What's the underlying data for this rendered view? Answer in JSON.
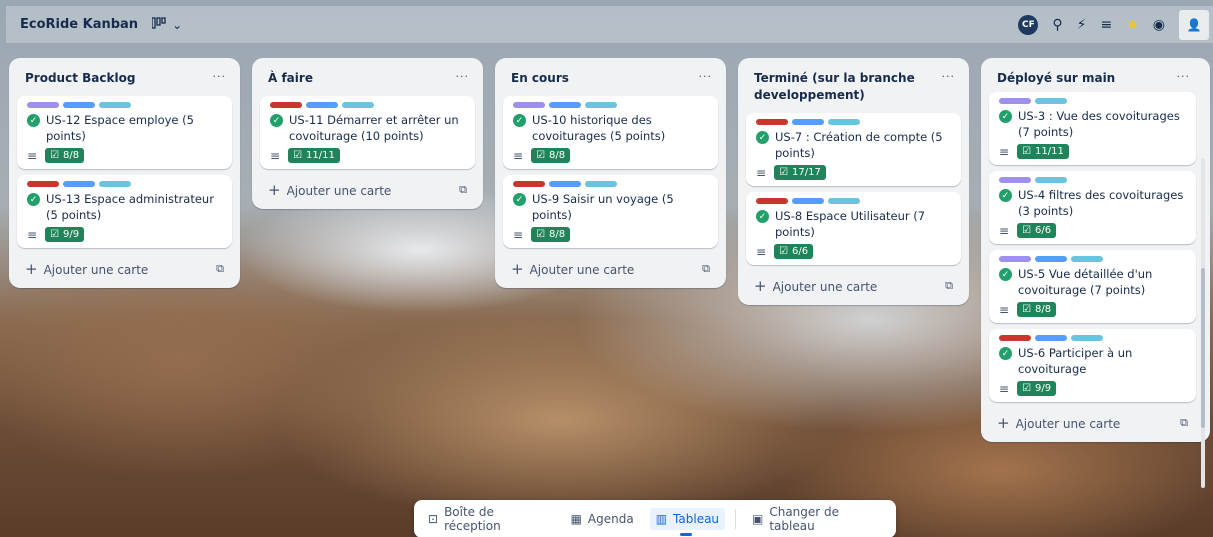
{
  "header": {
    "board_title": "EcoRide Kanban",
    "view_icon": "board-view-icon",
    "avatar_initials": "CF",
    "icons": [
      "pin-icon",
      "power-up-icon",
      "filter-icon",
      "star-icon",
      "visibility-icon",
      "share-icon"
    ]
  },
  "lists": [
    {
      "title": "Product Backlog",
      "add_label": "Ajouter une carte",
      "cards": [
        {
          "labels": [
            "purple",
            "blue",
            "teal"
          ],
          "title": "US-12 Espace employe (5 points)",
          "checklist": "8/8"
        },
        {
          "labels": [
            "red",
            "blue",
            "teal"
          ],
          "title": "US-13 Espace administrateur (5 points)",
          "checklist": "9/9"
        }
      ]
    },
    {
      "title": "À faire",
      "add_label": "Ajouter une carte",
      "cards": [
        {
          "labels": [
            "red",
            "blue",
            "teal"
          ],
          "title": "US-11 Démarrer et arrêter un covoiturage (10 points)",
          "checklist": "11/11"
        }
      ]
    },
    {
      "title": "En cours",
      "add_label": "Ajouter une carte",
      "cards": [
        {
          "labels": [
            "purple",
            "blue",
            "teal"
          ],
          "title": "US-10 historique des covoiturages (5 points)",
          "checklist": "8/8"
        },
        {
          "labels": [
            "red",
            "blue",
            "teal"
          ],
          "title": "US-9 Saisir un voyage (5 points)",
          "checklist": "8/8"
        }
      ]
    },
    {
      "title": "Terminé (sur la branche developpement)",
      "add_label": "Ajouter une carte",
      "cards": [
        {
          "labels": [
            "red",
            "blue",
            "teal"
          ],
          "title": "US-7 : Création de compte (5 points)",
          "checklist": "17/17"
        },
        {
          "labels": [
            "red",
            "blue",
            "teal"
          ],
          "title": "US-8 Espace Utilisateur (7 points)",
          "checklist": "6/6"
        }
      ]
    },
    {
      "title": "Déployé sur main",
      "add_label": "Ajouter une carte",
      "cards": [
        {
          "labels": [
            "purple",
            "teal"
          ],
          "title": "US-3 : Vue des covoiturages (7 points)",
          "checklist": "11/11"
        },
        {
          "labels": [
            "purple",
            "teal"
          ],
          "title": "US-4 filtres des covoiturages (3 points)",
          "checklist": "6/6"
        },
        {
          "labels": [
            "purple",
            "blue",
            "teal"
          ],
          "title": "US-5 Vue détaillée d'un covoiturage (7 points)",
          "checklist": "8/8"
        },
        {
          "labels": [
            "red",
            "blue",
            "teal"
          ],
          "title": "US-6 Participer à un covoiturage",
          "checklist": "9/9"
        }
      ]
    }
  ],
  "bottom_nav": {
    "inbox": "Boîte de réception",
    "agenda": "Agenda",
    "board": "Tableau",
    "switch": "Changer de tableau"
  },
  "colors": {
    "purple": "#9f8fef",
    "blue": "#579dff",
    "teal": "#6cc3e0",
    "red": "#c9372c",
    "checklist_green": "#1f845a"
  }
}
